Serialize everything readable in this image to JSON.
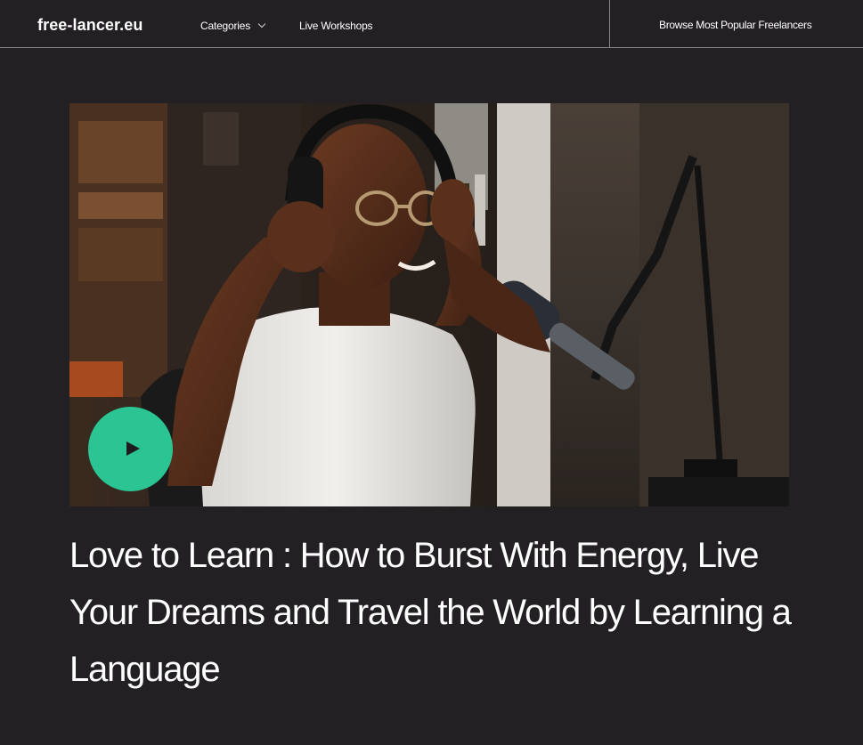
{
  "header": {
    "logo": "free-lancer.eu",
    "nav": {
      "categories_label": "Categories",
      "workshops_label": "Live Workshops"
    },
    "browse_label": "Browse Most Popular Freelancers"
  },
  "hero": {
    "image_alt": "Man wearing headphones speaking into a podcast microphone",
    "play_icon": "play-icon"
  },
  "article": {
    "title": "Love to Learn : How to Burst With Energy, Live Your Dreams and Travel the World by Learning a Language"
  },
  "colors": {
    "background": "#232024",
    "accent": "#2bc493",
    "text": "#ffffff"
  }
}
